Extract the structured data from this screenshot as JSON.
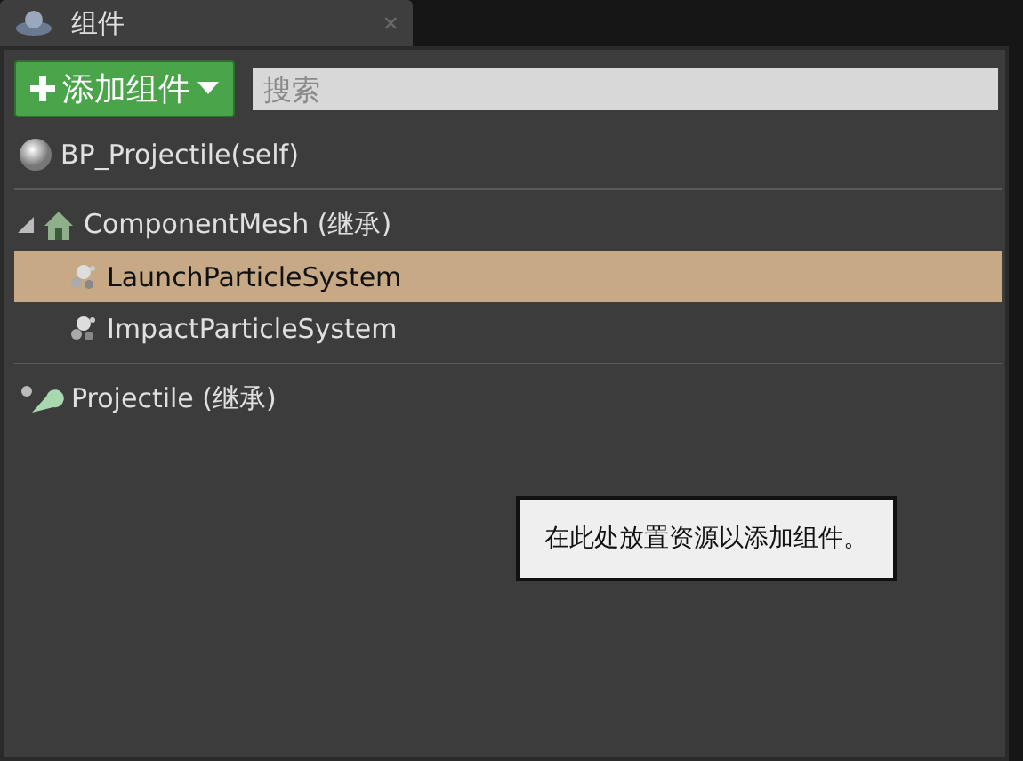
{
  "tab": {
    "title": "组件",
    "close": "×"
  },
  "toolbar": {
    "add_button": "添加组件",
    "search": {
      "placeholder": "搜索"
    }
  },
  "tree": [
    {
      "kind": "self",
      "label": "BP_Projectile(self)",
      "selected": false
    },
    {
      "kind": "mesh",
      "label": "ComponentMesh (继承)",
      "selected": false,
      "expanded": true,
      "children": [
        {
          "kind": "particle",
          "label": "LaunchParticleSystem",
          "selected": true
        },
        {
          "kind": "particle",
          "label": "ImpactParticleSystem",
          "selected": false
        }
      ]
    },
    {
      "kind": "projectile",
      "label": "Projectile (继承)",
      "selected": false
    }
  ],
  "drop_hint": "在此处放置资源以添加组件。"
}
